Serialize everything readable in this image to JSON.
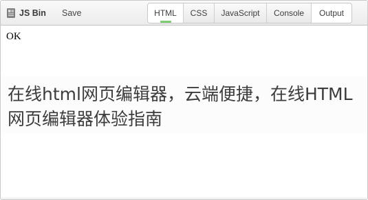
{
  "toolbar": {
    "brand_label": "JS Bin",
    "logo_icon": "jsbin-logo-icon",
    "save_label": "Save",
    "tabs": [
      {
        "label": "HTML",
        "active": true
      },
      {
        "label": "CSS",
        "active": false
      },
      {
        "label": "JavaScript",
        "active": false
      },
      {
        "label": "Console",
        "active": false
      },
      {
        "label": "Output",
        "active": true
      }
    ],
    "indicator_color": "#7ccd6f"
  },
  "output": {
    "text": "OK"
  },
  "caption": {
    "text": "在线html网页编辑器，云端便捷，在线HTML网页编辑器体验指南"
  }
}
